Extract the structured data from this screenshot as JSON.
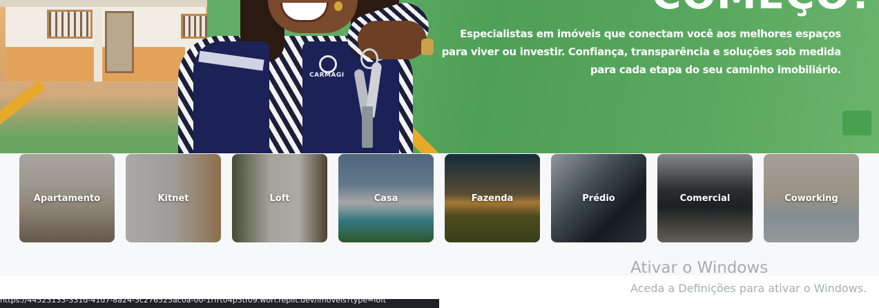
{
  "hero": {
    "headline": "COMEÇO?",
    "description": "Especialistas em imóveis que conectam você aos melhores espaços para viver ou investir. Confiança, transparência e soluções sob medida para cada etapa do seu caminho imobiliário.",
    "vest_logo": "CARMAGI",
    "accent_color": "#5aa85f",
    "stripe_color": "#e6a92b"
  },
  "categories": [
    {
      "label": "Apartamento"
    },
    {
      "label": "Kitnet"
    },
    {
      "label": "Loft"
    },
    {
      "label": "Casa"
    },
    {
      "label": "Fazenda"
    },
    {
      "label": "Prédio"
    },
    {
      "label": "Comercial"
    },
    {
      "label": "Coworking"
    }
  ],
  "windows_activation": {
    "title": "Ativar o Windows",
    "subtitle": "Aceda a Definições para ativar o Windows."
  },
  "status_bar": {
    "url": "https://44523133-331d-41d7-8a24-3c276525ac0a-00-1rfrt04p5tf09.worf.replit.dev/imoveis?type=loft"
  }
}
